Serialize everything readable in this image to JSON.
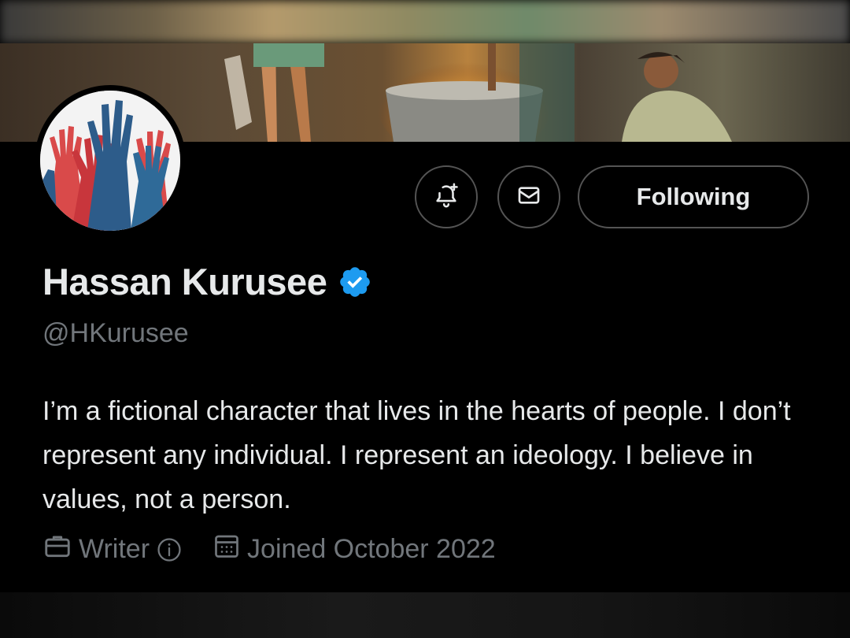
{
  "profile": {
    "display_name": "Hassan Kurusee",
    "handle": "@HKurusee",
    "verified": true,
    "bio": "I’m a fictional character that lives in the hearts of people. I don’t represent any individual. I represent an ideology. I believe in values, not a person.",
    "profession": "Writer",
    "joined": "Joined October 2022"
  },
  "actions": {
    "notify_icon": "bell-plus-icon",
    "message_icon": "envelope-icon",
    "follow_label": "Following"
  },
  "icons": {
    "verified": "verified-badge-icon",
    "profession": "briefcase-icon",
    "info": "info-icon",
    "joined": "calendar-icon"
  },
  "colors": {
    "background": "#000000",
    "text_primary": "#e7e9ea",
    "text_secondary": "#71767b",
    "verified_blue": "#1d9bf0",
    "border": "#545454"
  }
}
